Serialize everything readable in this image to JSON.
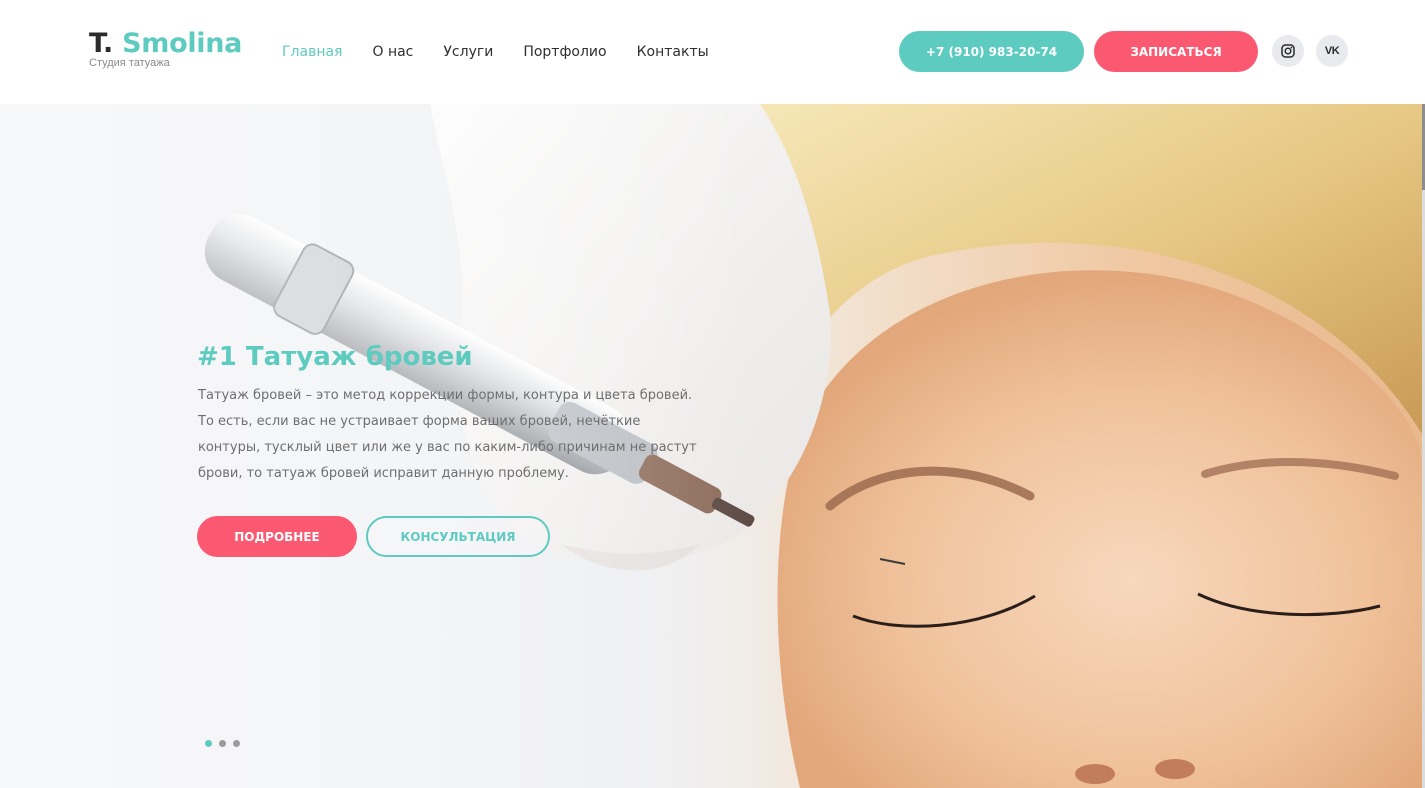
{
  "logo": {
    "prefix": "T.",
    "name": "Smolina",
    "subtitle": "Студия татуажа"
  },
  "nav": {
    "items": [
      {
        "label": "Главная",
        "active": true
      },
      {
        "label": "О нас",
        "active": false
      },
      {
        "label": "Услуги",
        "active": false
      },
      {
        "label": "Портфолио",
        "active": false
      },
      {
        "label": "Контакты",
        "active": false
      }
    ]
  },
  "header": {
    "phone": "+7 (910) 983-20-74",
    "book_label": "Записаться",
    "social": {
      "instagram_icon": "instagram-icon",
      "vk_label": "VK"
    }
  },
  "hero": {
    "title": "#1 Татуаж бровей",
    "text": "Татуаж бровей – это метод коррекции формы, контура и цвета бровей. То есть, если вас не устраивает форма ваших бровей, нечёткие контуры, тусклый цвет или же у вас по каким-либо причинам не растут брови, то татуаж бровей исправит данную проблему.",
    "more_label": "Подробнее",
    "consult_label": "Консультация",
    "slides": 3,
    "active_slide": 1
  },
  "colors": {
    "accent": "#5ecbc0",
    "cta": "#fb5871",
    "text": "#2f2f2f",
    "muted": "#6f6f6f"
  }
}
